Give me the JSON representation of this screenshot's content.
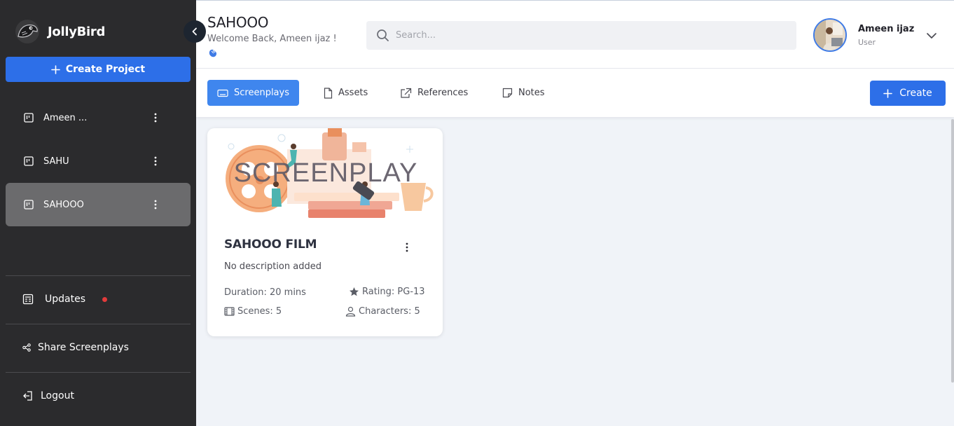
{
  "brand": {
    "name": "JollyBird"
  },
  "sidebar": {
    "create_project_label": "Create Project",
    "projects": [
      {
        "label": "Ameen ...",
        "active": false
      },
      {
        "label": "SAHU",
        "active": false
      },
      {
        "label": "SAHOOO",
        "active": true
      }
    ],
    "updates_label": "Updates",
    "share_label": "Share Screenplays",
    "logout_label": "Logout"
  },
  "header": {
    "title": "SAHOOO",
    "welcome": "Welcome Back, Ameen ijaz !",
    "search_placeholder": "Search...",
    "user_name": "Ameen ijaz",
    "user_role": "User"
  },
  "tabs": [
    {
      "label": "Screenplays",
      "icon": "keyboard-icon",
      "active": true
    },
    {
      "label": "Assets",
      "icon": "file-icon",
      "active": false
    },
    {
      "label": "References",
      "icon": "external-link-icon",
      "active": false
    },
    {
      "label": "Notes",
      "icon": "note-icon",
      "active": false
    }
  ],
  "create_label": "Create",
  "card": {
    "image_text": "SCREENPLAY",
    "title": "SAHOOO FILM",
    "description": "No description added",
    "duration": "Duration: 20 mins",
    "rating": "Rating: PG-13",
    "scenes": "Scenes: 5",
    "characters": "Characters: 5"
  },
  "colors": {
    "sidebar_bg": "#2b2b2d",
    "accent_blue": "#2d6fe8",
    "tab_active": "#3f86ee",
    "page_bg": "#f0f3f8",
    "updates_dot": "#e23b3b"
  }
}
